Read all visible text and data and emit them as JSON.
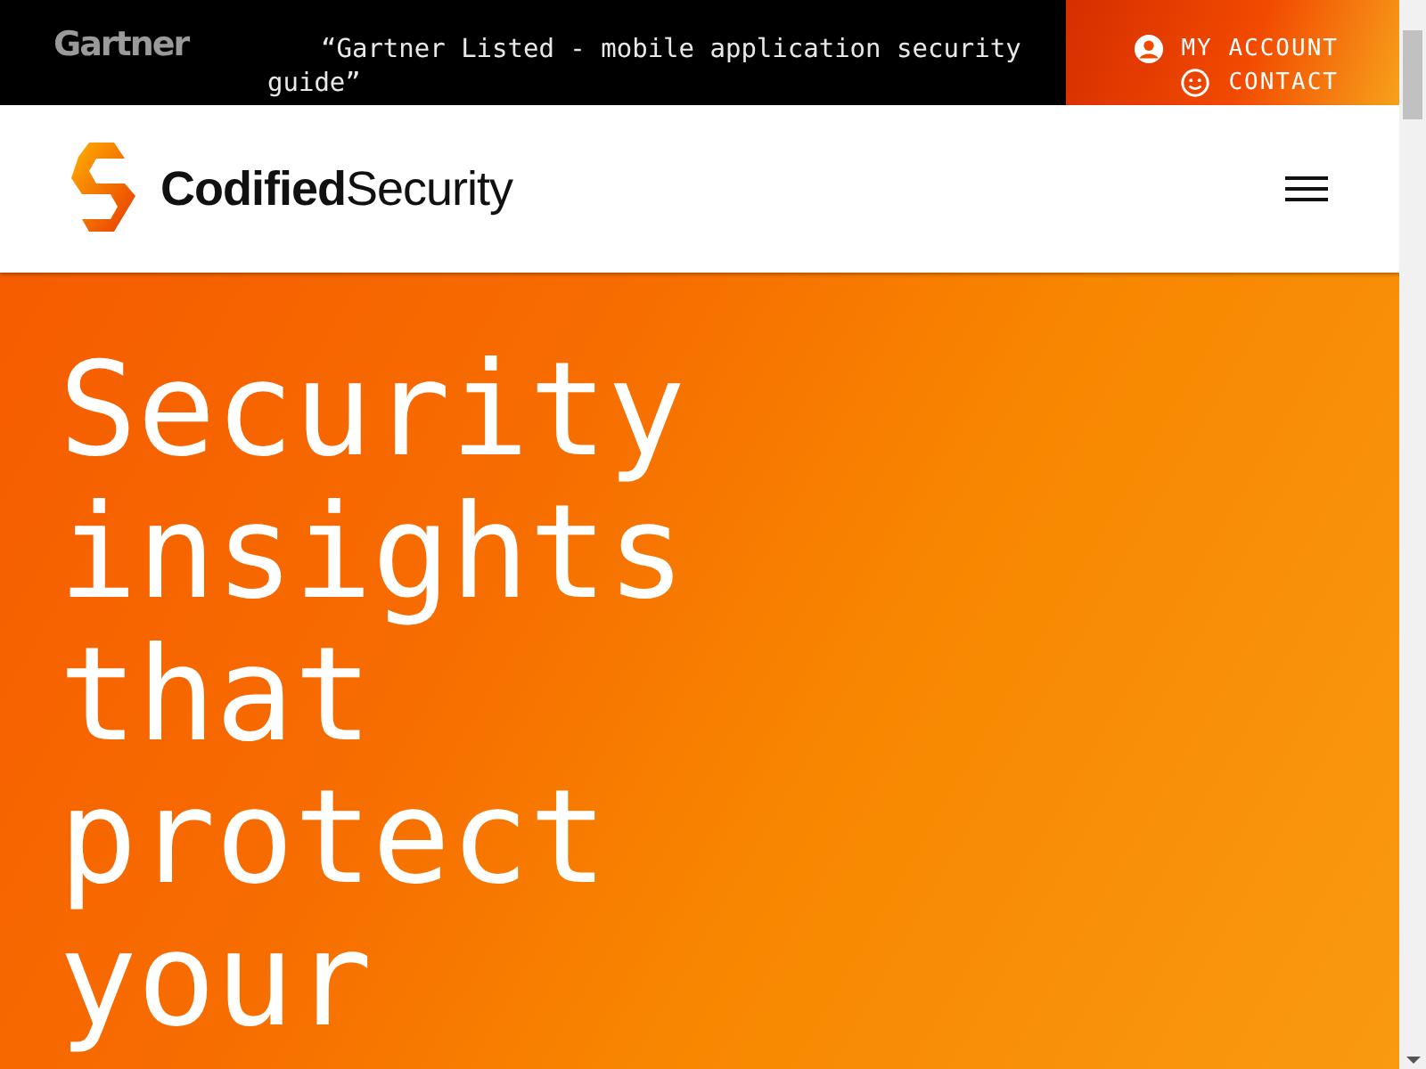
{
  "top_bar": {
    "brand": "Gartner",
    "announcement": "“Gartner Listed - mobile application security guide”",
    "links": [
      {
        "label": "MY ACCOUNT",
        "kind": "account"
      },
      {
        "label": "CONTACT",
        "kind": "contact"
      }
    ]
  },
  "header": {
    "logo_text": "**Codified**Security"
  },
  "hero": {
    "heading_lines": [
      "Security",
      "insights",
      "that",
      "protect",
      "your"
    ]
  }
}
